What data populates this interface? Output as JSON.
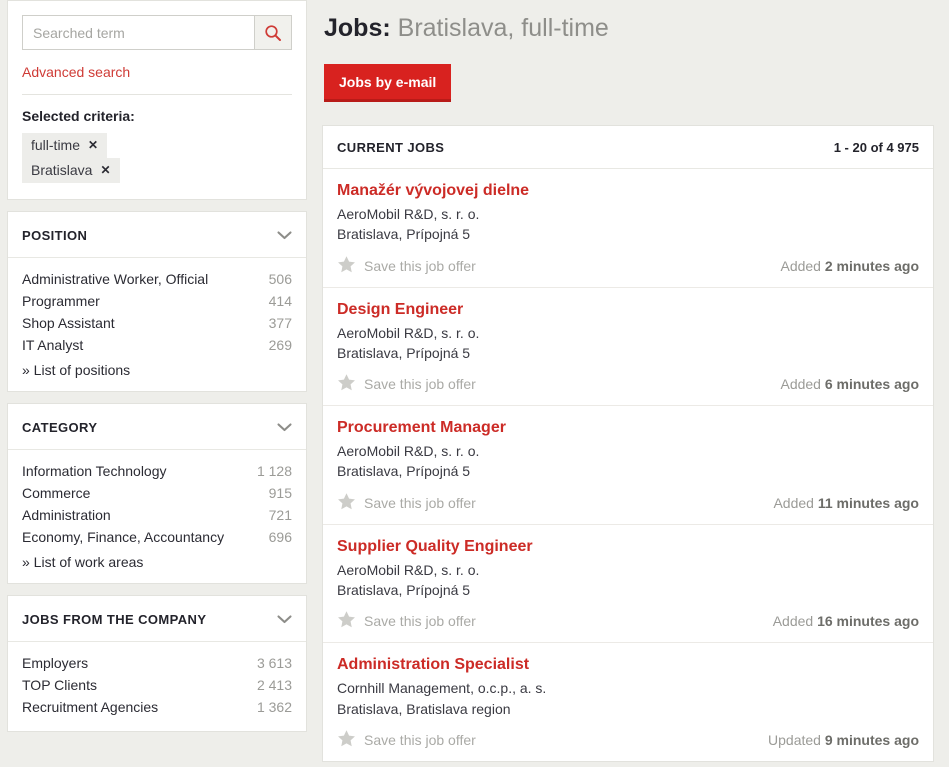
{
  "search": {
    "placeholder": "Searched term",
    "value": "",
    "search_icon": "search-icon",
    "advanced_link": "Advanced search"
  },
  "criteria": {
    "title": "Selected criteria:",
    "remove_glyph": "✕",
    "chips": [
      {
        "label": "full-time"
      },
      {
        "label": "Bratislava"
      }
    ]
  },
  "facets": [
    {
      "title": "POSITION",
      "chevron": "chevron-down-icon",
      "items": [
        {
          "label": "Administrative Worker, Official",
          "count": "506"
        },
        {
          "label": "Programmer",
          "count": "414"
        },
        {
          "label": "Shop Assistant",
          "count": "377"
        },
        {
          "label": "IT Analyst",
          "count": "269"
        }
      ],
      "more": "» List of positions"
    },
    {
      "title": "CATEGORY",
      "chevron": "chevron-down-icon",
      "items": [
        {
          "label": "Information Technology",
          "count": "1 128"
        },
        {
          "label": "Commerce",
          "count": "915"
        },
        {
          "label": "Administration",
          "count": "721"
        },
        {
          "label": "Economy, Finance, Accountancy",
          "count": "696"
        }
      ],
      "more": "» List of work areas"
    },
    {
      "title": "JOBS FROM THE COMPANY",
      "chevron": "chevron-down-icon",
      "items": [
        {
          "label": "Employers",
          "count": "3 613"
        },
        {
          "label": "TOP Clients",
          "count": "2 413"
        },
        {
          "label": "Recruitment Agencies",
          "count": "1 362"
        }
      ],
      "more": ""
    }
  ],
  "header": {
    "title_strong": "Jobs:",
    "title_sub": "Bratislava, full-time",
    "email_button": "Jobs by e-mail"
  },
  "jobs_panel": {
    "heading": "CURRENT JOBS",
    "range": "1 - 20 of 4 975",
    "save_label": "Save this job offer",
    "star_icon": "star-icon",
    "jobs": [
      {
        "title": "Manažér vývojovej dielne",
        "company": "AeroMobil R&D, s. r. o.",
        "location": "Bratislava, Prípojná 5",
        "date_prefix": "Added",
        "date_value": "2 minutes ago"
      },
      {
        "title": "Design Engineer",
        "company": "AeroMobil R&D, s. r. o.",
        "location": "Bratislava, Prípojná 5",
        "date_prefix": "Added",
        "date_value": "6 minutes ago"
      },
      {
        "title": "Procurement Manager",
        "company": "AeroMobil R&D, s. r. o.",
        "location": "Bratislava, Prípojná 5",
        "date_prefix": "Added",
        "date_value": "11 minutes ago"
      },
      {
        "title": "Supplier Quality Engineer",
        "company": "AeroMobil R&D, s. r. o.",
        "location": "Bratislava, Prípojná 5",
        "date_prefix": "Added",
        "date_value": "16 minutes ago"
      },
      {
        "title": "Administration Specialist",
        "company": "Cornhill Management, o.c.p., a. s.",
        "location": "Bratislava, Bratislava region",
        "date_prefix": "Updated",
        "date_value": "9 minutes ago"
      }
    ]
  },
  "colors": {
    "accent_red": "#cc2b26",
    "button_red": "#d8221f",
    "page_bg": "#eeeeea",
    "muted": "#9b9b97"
  }
}
